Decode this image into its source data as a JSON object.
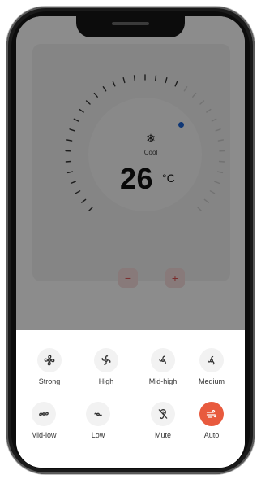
{
  "thermostat": {
    "mode_icon": "snowflake-icon",
    "mode_label": "Cool",
    "temperature": "26",
    "unit": "°C",
    "minus_label": "−",
    "plus_label": "+"
  },
  "fan_speed": {
    "selected": "Auto",
    "accent_color": "#e85a3e",
    "options": [
      {
        "label": "Strong",
        "icon": "fan-strong-icon"
      },
      {
        "label": "High",
        "icon": "fan-high-icon"
      },
      {
        "label": "Mid-high",
        "icon": "fan-mid-high-icon"
      },
      {
        "label": "Medium",
        "icon": "fan-medium-icon"
      },
      {
        "label": "Mid-low",
        "icon": "fan-mid-low-icon"
      },
      {
        "label": "Low",
        "icon": "fan-low-icon"
      },
      {
        "label": "Mute",
        "icon": "ear-mute-icon"
      },
      {
        "label": "Auto",
        "icon": "wind-auto-icon"
      }
    ]
  }
}
